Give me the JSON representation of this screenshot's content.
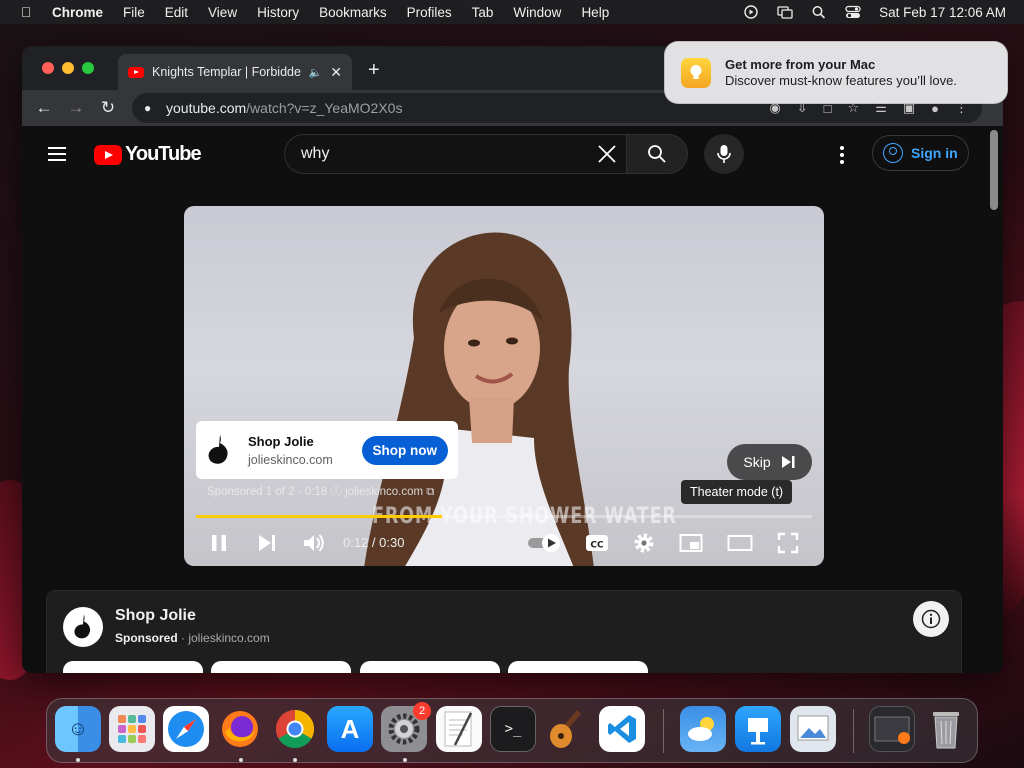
{
  "menubar": {
    "app_name": "Chrome",
    "menus": [
      "File",
      "Edit",
      "View",
      "History",
      "Bookmarks",
      "Profiles",
      "Tab",
      "Window",
      "Help"
    ],
    "clock": "Sat Feb 17  12:06 AM"
  },
  "browser": {
    "tab_title": "Knights Templar | Forbidde",
    "url_host": "youtube.com",
    "url_path": "/watch?v=z_YeaMO2X0s"
  },
  "youtube": {
    "logo_text": "YouTube",
    "search_value": "why",
    "signin_label": "Sign in"
  },
  "player": {
    "ad_brand": "Shop Jolie",
    "ad_domain": "jolieskinco.com",
    "cta_label": "Shop now",
    "sponsored_line": "Sponsored 1 of 2 · 0:18  ⓘ   jolieskinco.com ⧉",
    "skip_label": "Skip",
    "tooltip": "Theater mode (t)",
    "caption": "FROM YOUR SHOWER WATER",
    "time": "0:12 / 0:30",
    "progress_fraction": 0.4
  },
  "ad_panel": {
    "title": "Shop Jolie",
    "sponsored": "Sponsored",
    "domain": "· jolieskinco.com"
  },
  "notification": {
    "title": "Get more from your Mac",
    "body": "Discover must-know features you’ll love."
  },
  "dock": {
    "badge_count": "2",
    "apps": [
      "Finder",
      "Launchpad",
      "Safari",
      "Firefox",
      "Chrome",
      "App Store",
      "System Settings",
      "TextEdit",
      "Terminal",
      "GarageBand",
      "VS Code",
      "Weather",
      "Keynote",
      "Preview",
      "Downloads",
      "Trash"
    ]
  },
  "colors": {
    "youtube_red": "#ff0000",
    "link_blue": "#3ea6ff",
    "cta_blue": "#065fd4",
    "ad_progress": "#ffcc00"
  }
}
